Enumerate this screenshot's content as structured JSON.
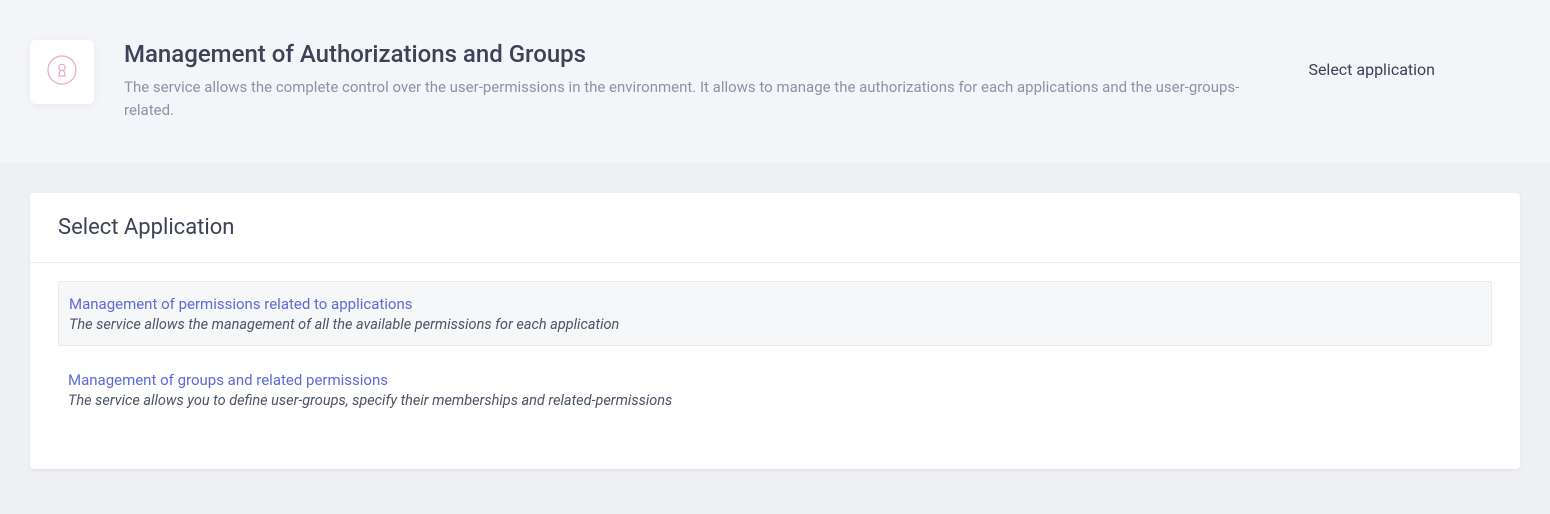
{
  "header": {
    "title": "Management of Authorizations and Groups",
    "description": "The service allows the complete control over the user-permissions in the environment. It allows to manage the authorizations for each applications and the user-groups-related.",
    "breadcrumb": "Select application",
    "icon": "keyhole-icon"
  },
  "card": {
    "title": "Select Application",
    "options": [
      {
        "link": "Management of permissions related to applications",
        "description": "The service allows the management of all the available permissions for each application",
        "highlighted": true
      },
      {
        "link": "Management of groups and related permissions",
        "description": "The service allows you to define user-groups, specify their memberships and related-permissions",
        "highlighted": false
      }
    ]
  }
}
